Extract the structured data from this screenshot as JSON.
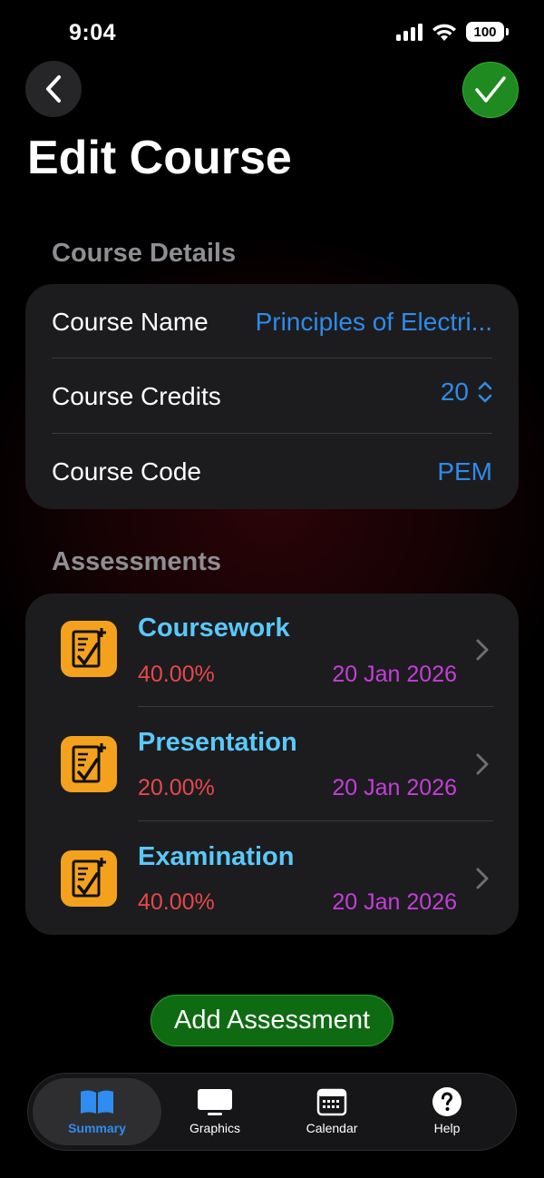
{
  "status_bar": {
    "time": "9:04",
    "battery": "100"
  },
  "nav": {
    "title": "Edit Course"
  },
  "course_details": {
    "header": "Course Details",
    "rows": [
      {
        "label": "Course Name",
        "value": "Principles of Electri..."
      },
      {
        "label": "Course Credits",
        "value": "20"
      },
      {
        "label": "Course Code",
        "value": "PEM"
      }
    ]
  },
  "assessments": {
    "header": "Assessments",
    "items": [
      {
        "name": "Coursework",
        "weight": "40.00%",
        "date": "20 Jan 2026"
      },
      {
        "name": "Presentation",
        "weight": "20.00%",
        "date": "20 Jan 2026"
      },
      {
        "name": "Examination",
        "weight": "40.00%",
        "date": "20 Jan 2026"
      }
    ]
  },
  "add_button": {
    "label": "Add Assessment"
  },
  "tabs": [
    {
      "label": "Summary",
      "icon": "book-icon"
    },
    {
      "label": "Graphics",
      "icon": "display-icon"
    },
    {
      "label": "Calendar",
      "icon": "calendar-icon"
    },
    {
      "label": "Help",
      "icon": "question-icon"
    }
  ],
  "colors": {
    "accent_blue": "#2e8bea",
    "assessment_name": "#5ac8fa",
    "weight_red": "#e5484d",
    "date_purple": "#c43ed9",
    "icon_orange": "#f4a21e",
    "confirm_green": "#1f8a1f"
  }
}
